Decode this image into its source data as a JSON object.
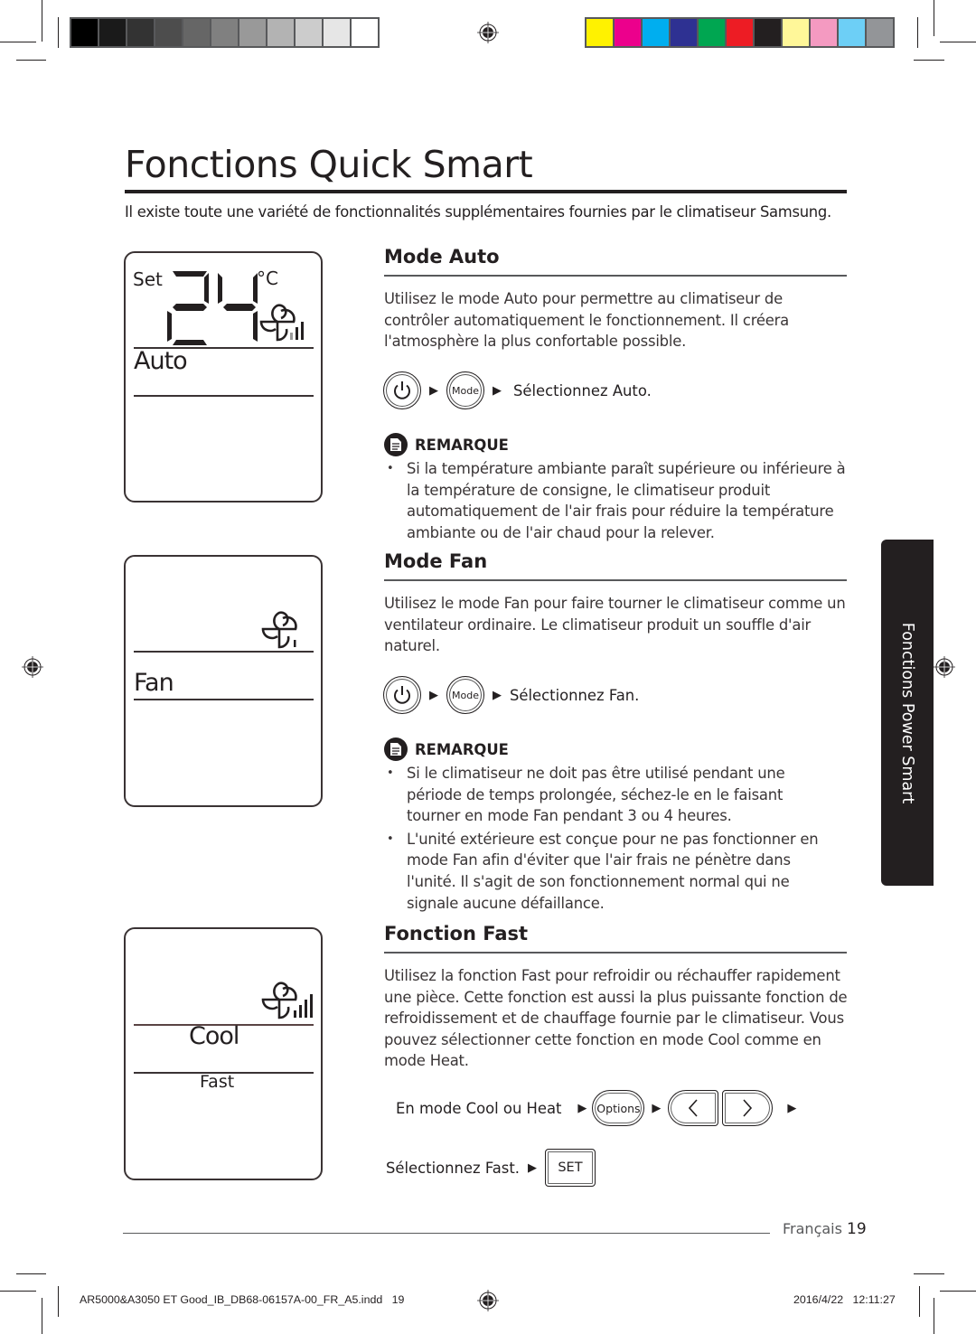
{
  "printer_marks": {
    "grayscale_swatches": [
      "#000000",
      "#1a1a1a",
      "#333333",
      "#4d4d4d",
      "#666666",
      "#808080",
      "#999999",
      "#b3b3b3",
      "#cccccc",
      "#e6e6e6",
      "#ffffff"
    ],
    "color_swatches": [
      "#fff200",
      "#ec008c",
      "#00aeef",
      "#2e3192",
      "#00a651",
      "#ed1c24",
      "#231f20",
      "#fff799",
      "#f49ac1",
      "#6dcff6",
      "#939598"
    ]
  },
  "page": {
    "title": "Fonctions Quick Smart",
    "intro": "Il existe toute une variété de fonctionnalités supplémentaires fournies par le climatiseur Samsung."
  },
  "displays": {
    "auto": {
      "set_label": "Set",
      "temperature": "24",
      "unit": "°C",
      "mode": "Auto",
      "fan_level_bars": 3,
      "fan_level_active": 1
    },
    "fan": {
      "mode": "Fan",
      "fan_level_bars": 1
    },
    "cool": {
      "mode": "Cool",
      "option": "Fast",
      "fan_level_bars": 4
    }
  },
  "sections": {
    "auto": {
      "title": "Mode Auto",
      "description": "Utilisez le mode Auto pour permettre au climatiseur de contrôler automatiquement le fonctionnement. Il créera l'atmosphère la plus confortable possible.",
      "step_button": "Mode",
      "step_text": "Sélectionnez Auto.",
      "remark_label": "REMARQUE",
      "remarks": [
        "Si la température ambiante paraît supérieure ou inférieure à la température de consigne, le climatiseur produit automatiquement de l'air frais pour réduire la température ambiante ou de l'air chaud pour la relever."
      ]
    },
    "fan": {
      "title": "Mode Fan",
      "description": "Utilisez le mode Fan pour faire tourner le climatiseur comme un ventilateur ordinaire. Le climatiseur produit un souffle d'air naturel.",
      "step_button": "Mode",
      "step_text": "Sélectionnez Fan.",
      "remark_label": "REMARQUE",
      "remarks": [
        "Si le climatiseur ne doit pas être utilisé pendant une période de temps prolongée, séchez-le en le faisant tourner en mode Fan pendant 3 ou 4 heures.",
        "L'unité extérieure est conçue pour ne pas fonctionner en mode Fan afin d'éviter que l'air frais ne pénètre dans l'unité. Il s'agit de son fonctionnement normal qui ne signale aucune défaillance."
      ]
    },
    "fast": {
      "title": "Fonction Fast",
      "description": "Utilisez la fonction Fast pour refroidir ou réchauffer rapidement une pièce. Cette fonction est aussi la plus puissante fonction de refroidissement et de chauffage fournie par le climatiseur. Vous pouvez sélectionner cette fonction en mode Cool comme en mode Heat.",
      "step1_text": "En mode Cool ou Heat",
      "options_button": "Options",
      "left_button": "<",
      "right_button": ">",
      "step2_text": "Sélectionnez Fast.",
      "set_button": "SET"
    }
  },
  "side_tab": {
    "label": "Fonctions Power Smart"
  },
  "footer": {
    "language": "Français",
    "page_number": "19",
    "slug_file": "AR5000&A3050 ET Good_IB_DB68-06157A-00_FR_A5.indd   19",
    "slug_date": "2016/4/22   12:11:27"
  }
}
